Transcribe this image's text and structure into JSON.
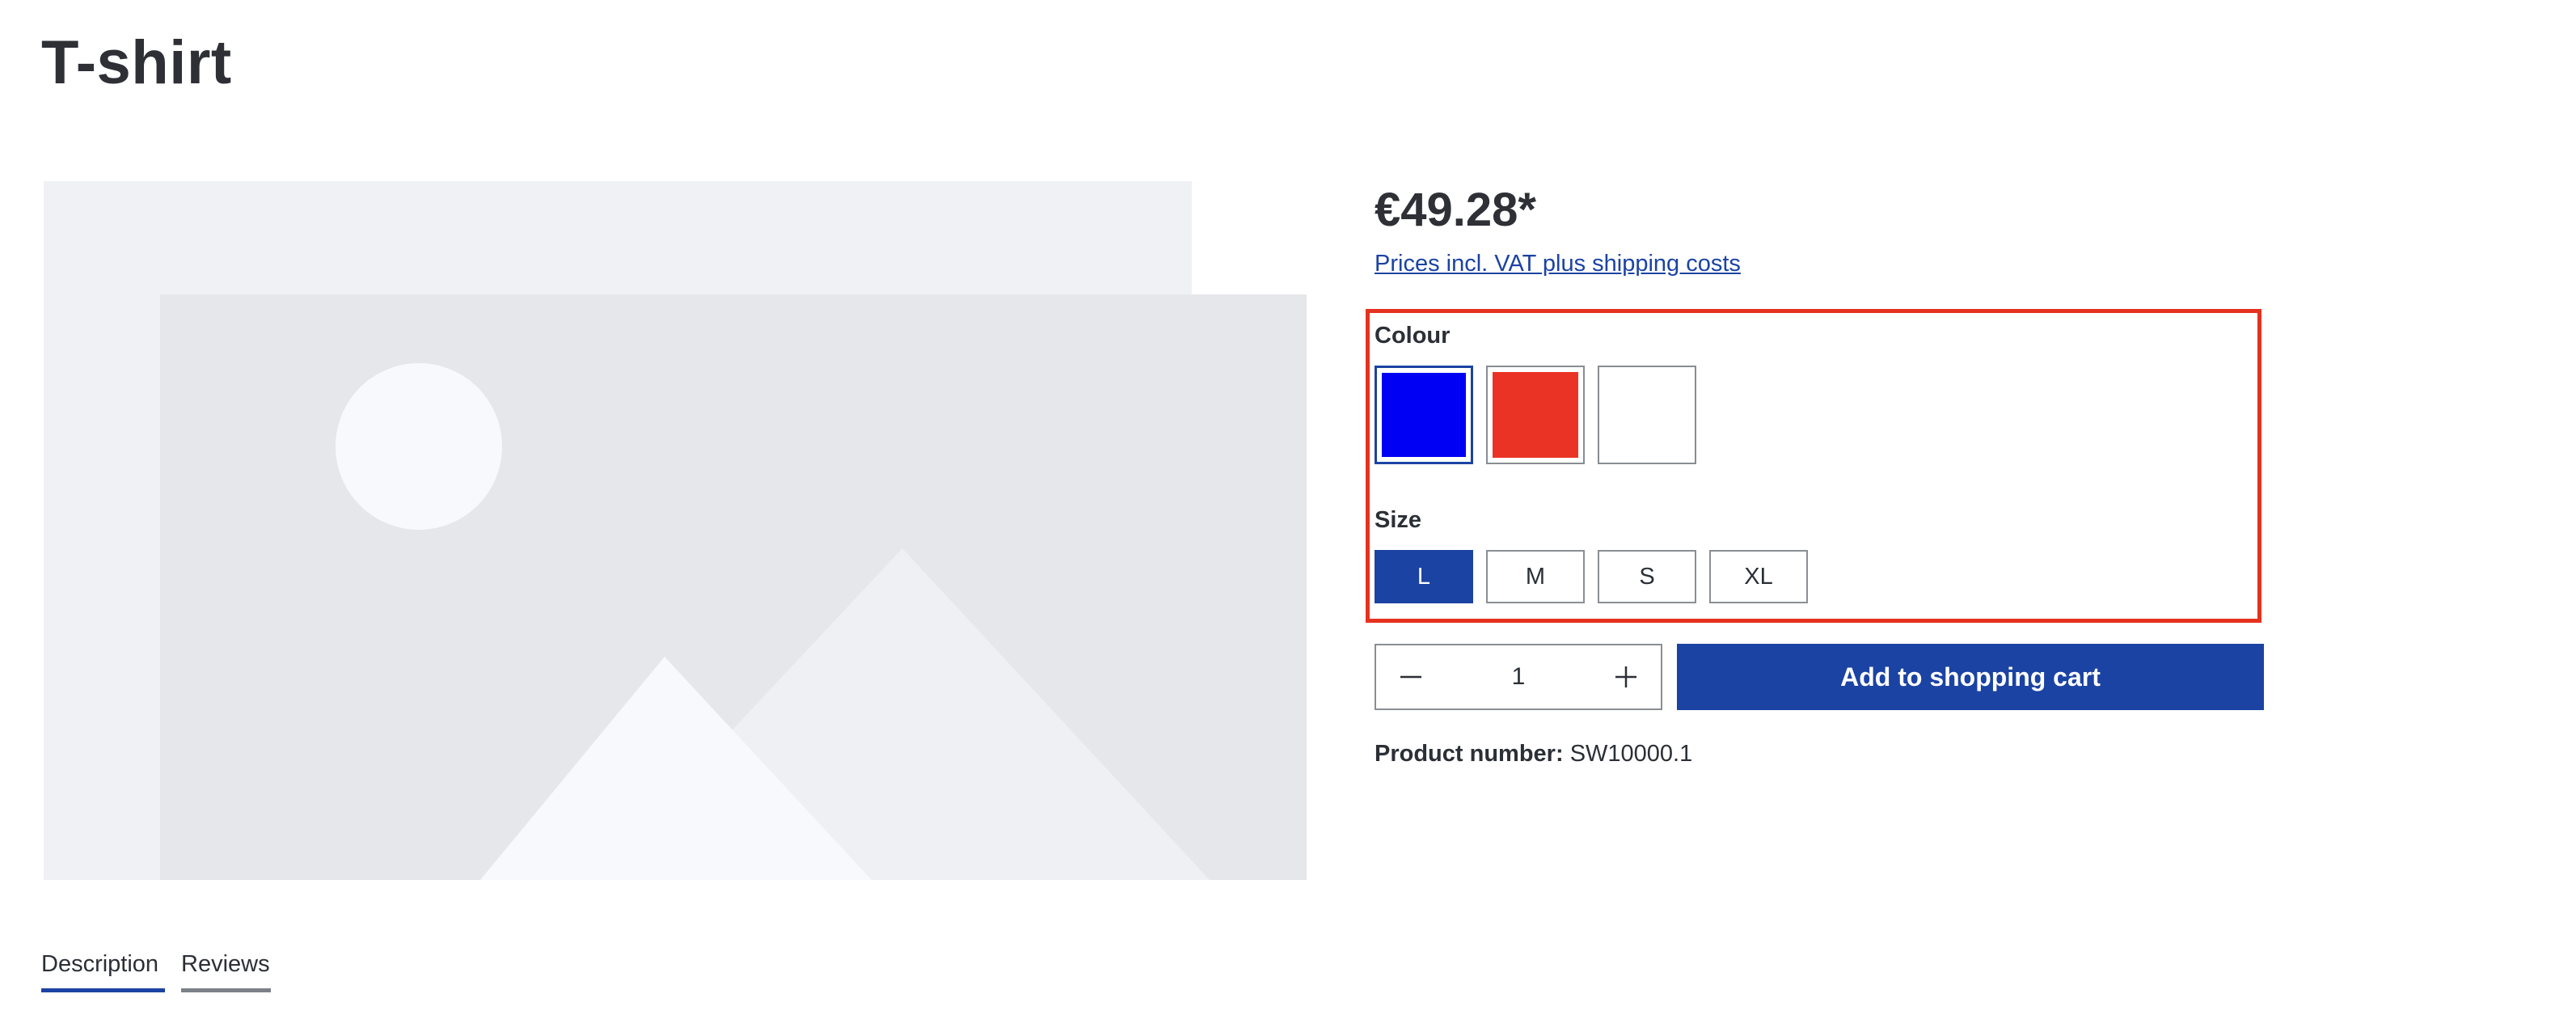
{
  "product": {
    "title": "T-shirt",
    "price": "€49.28*",
    "tax_link": "Prices incl. VAT plus shipping costs"
  },
  "configurator": {
    "colour_label": "Colour",
    "colours": [
      {
        "name": "blue",
        "hex": "#0000f5",
        "selected": true
      },
      {
        "name": "red",
        "hex": "#ea3324",
        "selected": false
      },
      {
        "name": "white",
        "hex": "#ffffff",
        "selected": false
      }
    ],
    "size_label": "Size",
    "sizes": [
      {
        "label": "L",
        "selected": true
      },
      {
        "label": "M",
        "selected": false
      },
      {
        "label": "S",
        "selected": false
      },
      {
        "label": "XL",
        "selected": false
      }
    ]
  },
  "purchase": {
    "quantity": "1",
    "add_to_cart_label": "Add to shopping cart",
    "product_number_label": "Product number:",
    "product_number": "SW10000.1"
  },
  "tabs": [
    {
      "label": "Description",
      "active": true
    },
    {
      "label": "Reviews",
      "active": false
    }
  ],
  "colors": {
    "accent": "#1b43a3",
    "highlight": "#e5321f",
    "text": "#2b2f36"
  },
  "icons": {
    "minus": "minus-icon",
    "plus": "plus-icon",
    "image_placeholder": "image-placeholder-icon"
  }
}
